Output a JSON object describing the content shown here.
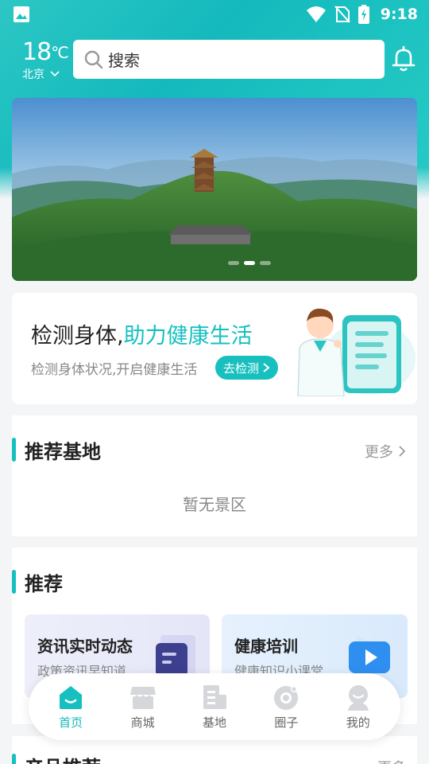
{
  "status_bar": {
    "time": "9:18"
  },
  "weather": {
    "temperature": "18",
    "unit": "℃",
    "city": "北京"
  },
  "search": {
    "placeholder": "搜索"
  },
  "banner": {
    "slide_count": 3,
    "active_index": 1
  },
  "health_card": {
    "title_plain": "检测身体,",
    "title_highlight": "助力健康生活",
    "subtitle": "检测身体状况,开启健康生活",
    "button_label": "去检测"
  },
  "recommended_base": {
    "title": "推荐基地",
    "more_label": "更多",
    "empty_text": "暂无景区"
  },
  "recommend": {
    "title": "推荐",
    "tiles": [
      {
        "title": "资讯实时动态",
        "subtitle": "政策资讯早知道",
        "icon": "document-icon"
      },
      {
        "title": "健康培训",
        "subtitle": "健康知识小课堂",
        "icon": "play-video-icon"
      }
    ]
  },
  "product_section": {
    "title": "产品推荐",
    "more_label": "更多"
  },
  "bottom_nav": {
    "items": [
      {
        "label": "首页",
        "icon": "home-icon",
        "active": true
      },
      {
        "label": "商城",
        "icon": "shop-icon",
        "active": false
      },
      {
        "label": "基地",
        "icon": "base-building-icon",
        "active": false
      },
      {
        "label": "圈子",
        "icon": "circle-community-icon",
        "active": false
      },
      {
        "label": "我的",
        "icon": "profile-icon",
        "active": false
      }
    ]
  },
  "colors": {
    "accent": "#17c0bf",
    "header_bg": "#1ec4c1"
  }
}
